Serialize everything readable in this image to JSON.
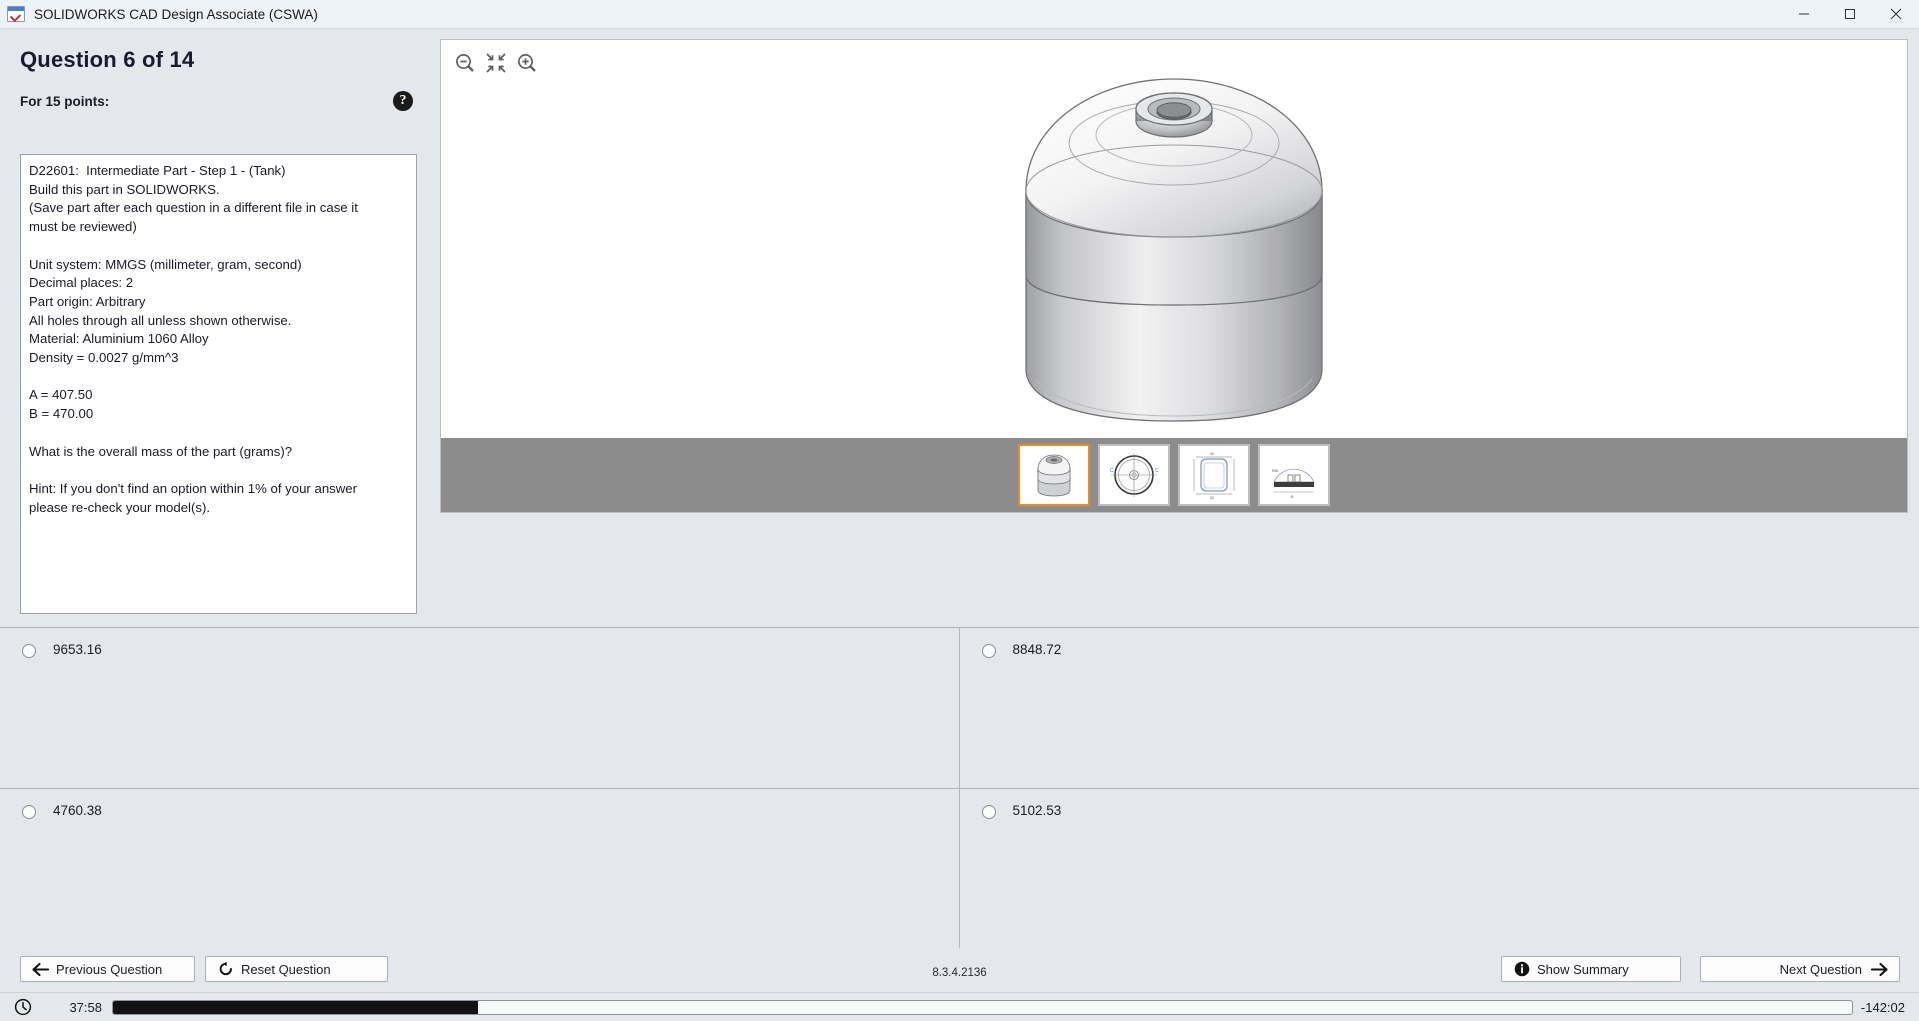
{
  "titlebar": {
    "app_icon": "solidworks-exam-icon",
    "title": "SOLIDWORKS CAD Design Associate (CSWA)",
    "minimize_label": "Minimize",
    "maximize_label": "Maximize",
    "close_label": "Close"
  },
  "question": {
    "heading": "Question 6 of 14",
    "points_label": "For 15 points:",
    "help_icon": "?",
    "body": "D22601:  Intermediate Part - Step 1 - (Tank)\nBuild this part in SOLIDWORKS.\n(Save part after each question in a different file in case it\nmust be reviewed)\n\nUnit system: MMGS (millimeter, gram, second)\nDecimal places: 2\nPart origin: Arbitrary\nAll holes through all unless shown otherwise.\nMaterial: Aluminium 1060 Alloy\nDensity = 0.0027 g/mm^3\n\nA = 407.50\nB = 470.00\n\nWhat is the overall mass of the part (grams)?\n\nHint: If you don't find an option within 1% of your answer\nplease re-check your model(s)."
  },
  "viewer": {
    "tools": [
      {
        "name": "zoom-out-icon",
        "label": "Zoom Out"
      },
      {
        "name": "zoom-to-fit-icon",
        "label": "Zoom to Fit"
      },
      {
        "name": "zoom-in-icon",
        "label": "Zoom In"
      }
    ],
    "thumbnails": [
      {
        "name": "thumbnail-isometric",
        "label": "Isometric view",
        "selected": true
      },
      {
        "name": "thumbnail-top-view",
        "label": "Top view",
        "selected": false
      },
      {
        "name": "thumbnail-section-drawing",
        "label": "Section drawing",
        "selected": false
      },
      {
        "name": "thumbnail-detail-drawing",
        "label": "Detail drawing",
        "selected": false
      }
    ]
  },
  "answers": [
    {
      "value": "9653.16",
      "selected": false
    },
    {
      "value": "8848.72",
      "selected": false
    },
    {
      "value": "4760.38",
      "selected": false
    },
    {
      "value": "5102.53",
      "selected": false
    }
  ],
  "actions": {
    "previous": "Previous Question",
    "reset": "Reset Question",
    "summary": "Show Summary",
    "next": "Next Question",
    "version": "8.3.4.2136"
  },
  "status": {
    "clock_icon": "clock-icon",
    "elapsed": "37:58",
    "remaining": "-142:02",
    "progress_percent": 21
  },
  "colors": {
    "accent": "#f08a1e",
    "window_bg": "#e4e8ec",
    "titlebar_bg": "#eef3fa",
    "thumbstrip_bg": "#8c8c8c",
    "progress_fill": "#111111"
  }
}
